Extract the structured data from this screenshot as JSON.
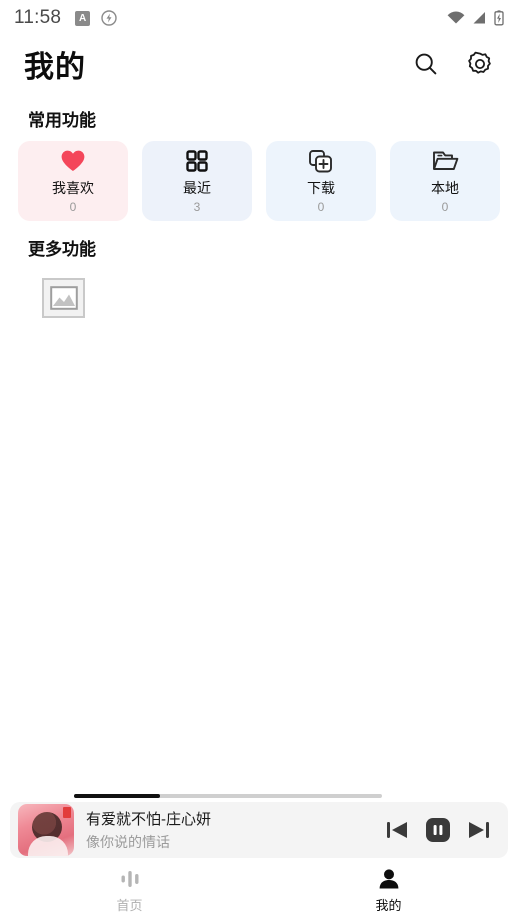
{
  "status_bar": {
    "time": "11:58",
    "left_icons": [
      {
        "name": "app-badge-icon",
        "glyph": "A"
      },
      {
        "name": "flash-circle-icon"
      }
    ],
    "right_icons": [
      "wifi-icon",
      "cellular-signal-icon",
      "battery-charging-icon"
    ]
  },
  "header": {
    "title": "我的",
    "search_icon": "search-icon",
    "settings_icon": "gear-icon"
  },
  "sections": {
    "common": {
      "title": "常用功能",
      "cards": [
        {
          "label": "我喜欢",
          "count": "0",
          "icon": "heart-icon",
          "bg": "#fdeef0",
          "icon_color": "#f4465a"
        },
        {
          "label": "最近",
          "count": "3",
          "icon": "grid-icon",
          "bg": "#edf2fa",
          "icon_color": "#111111"
        },
        {
          "label": "下载",
          "count": "0",
          "icon": "download-plus-icon",
          "bg": "#edf4fc",
          "icon_color": "#2b2b2b"
        },
        {
          "label": "本地",
          "count": "0",
          "icon": "folder-icon",
          "bg": "#edf4fc",
          "icon_color": "#2b2b2b"
        }
      ]
    },
    "more": {
      "title": "更多功能",
      "items": [
        {
          "name": "broken-image-placeholder",
          "icon": "image-placeholder-icon"
        }
      ]
    }
  },
  "player": {
    "album_art": "album-art-thumbnail",
    "title": "有爱就不怕-庄心妍",
    "subtitle": "像你说的情话",
    "progress_percent": 28,
    "controls": [
      {
        "name": "previous-button",
        "icon": "skip-previous-icon"
      },
      {
        "name": "pause-button",
        "icon": "pause-icon"
      },
      {
        "name": "next-button",
        "icon": "skip-next-icon"
      }
    ]
  },
  "bottom_nav": {
    "items": [
      {
        "label": "首页",
        "icon": "audio-bars-icon",
        "active": false
      },
      {
        "label": "我的",
        "icon": "person-icon",
        "active": true
      }
    ]
  },
  "colors": {
    "accent_red": "#f4465a",
    "text_primary": "#111111",
    "text_muted": "#9a9a9a",
    "player_bg": "#f4f4f4"
  }
}
